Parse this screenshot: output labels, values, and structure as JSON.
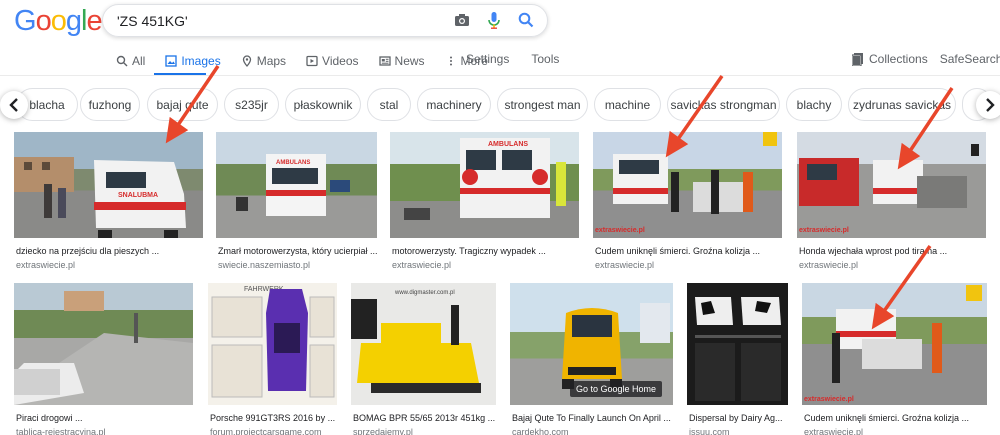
{
  "logo": [
    "G",
    "o",
    "o",
    "g",
    "l",
    "e"
  ],
  "logo_colors": [
    "#4285f4",
    "#ea4335",
    "#fbbc05",
    "#4285f4",
    "#34a853",
    "#ea4335"
  ],
  "search": {
    "query": "'ZS 451KG'"
  },
  "tabs": {
    "all": "All",
    "images": "Images",
    "maps": "Maps",
    "videos": "Videos",
    "news": "News",
    "more": "More"
  },
  "tools": {
    "settings": "Settings",
    "tools": "Tools",
    "collections": "Collections",
    "safesearch": "SafeSearch"
  },
  "chips": [
    "blacha",
    "fuzhong",
    "bajaj qute",
    "s235jr",
    "płaskownik",
    "stal",
    "machinery",
    "strongest man",
    "machine",
    "savickas strongman",
    "blachy",
    "zydrunas savickas"
  ],
  "results": [
    {
      "caption": "dziecko na przejściu dla pieszych ...",
      "source": "extraswiecie.pl"
    },
    {
      "caption": "Zmarł motorowerzysta, który ucierpiał ...",
      "source": "swiecie.naszemiasto.pl"
    },
    {
      "caption": "motorowerzysty. Tragiczny wypadek ...",
      "source": "extraswiecie.pl"
    },
    {
      "caption": "Cudem uniknęli śmierci. Groźna kolizja ...",
      "source": "extraswiecie.pl"
    },
    {
      "caption": "Honda wjechała wprost pod tira na ...",
      "source": "extraswiecie.pl"
    },
    {
      "caption": "Piraci drogowi ...",
      "source": "tablica-rejestracyjna.pl"
    },
    {
      "caption": "Porsche 991GT3RS 2016 by ...",
      "source": "forum.projectcarsgame.com"
    },
    {
      "caption": "BOMAG BPR 55/65 2013r 451kg ...",
      "source": "sprzedajemy.pl"
    },
    {
      "caption": "Bajaj Qute To Finally Launch On April ...",
      "source": "cardekho.com"
    },
    {
      "caption": "Dispersal by Dairy Ag...",
      "source": "issuu.com"
    },
    {
      "caption": "Cudem uniknęli śmierci. Groźna kolizja ...",
      "source": "extraswiecie.pl"
    }
  ],
  "image_text": {
    "ambulans": "AMBULANS",
    "ambulans_rev": "SNALUBMA",
    "watermark": "extraswiecie.pl",
    "farnwerk": "FAHRWERK",
    "digmaster": "www.digmaster.com.pl",
    "tooltip": "Go to Google Home"
  }
}
